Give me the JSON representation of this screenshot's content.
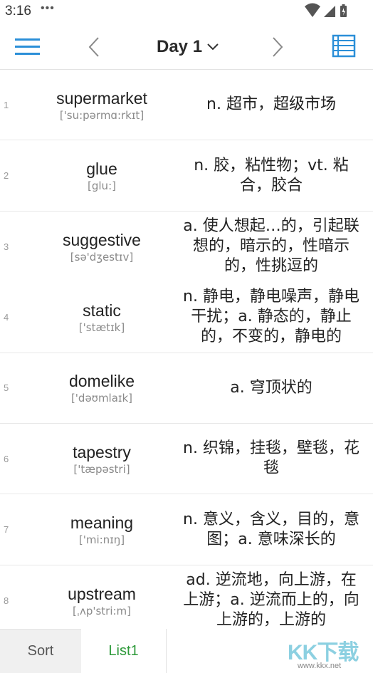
{
  "status_bar": {
    "time": "3:16",
    "dots": "•••"
  },
  "header": {
    "menu_icon": "hamburger-menu-icon",
    "prev_icon": "chevron-left-icon",
    "title": "Day 1",
    "dropdown_icon": "chevron-down-icon",
    "next_icon": "chevron-right-icon",
    "list_icon": "list-view-icon",
    "accent_color": "#2b8fd8"
  },
  "words": [
    {
      "index": "1",
      "word": "supermarket",
      "phonetic": "['su:pərmɑ:rkɪt]",
      "meaning": "n. 超市，超级市场"
    },
    {
      "index": "2",
      "word": "glue",
      "phonetic": "[glu:]",
      "meaning": "n. 胶，粘性物；vt. 粘合，胶合"
    },
    {
      "index": "3",
      "word": "suggestive",
      "phonetic": "[sə'dʒestɪv]",
      "meaning": "a. 使人想起…的，引起联想的，暗示的，性暗示的，性挑逗的"
    },
    {
      "index": "4",
      "word": "static",
      "phonetic": "['stætɪk]",
      "meaning": "n. 静电，静电噪声，静电干扰；a. 静态的，静止的，不变的，静电的"
    },
    {
      "index": "5",
      "word": "domelike",
      "phonetic": "['dəʊmlaɪk]",
      "meaning": "a. 穹顶状的"
    },
    {
      "index": "6",
      "word": "tapestry",
      "phonetic": "['tæpəstri]",
      "meaning": "n. 织锦，挂毯，壁毯，花毯"
    },
    {
      "index": "7",
      "word": "meaning",
      "phonetic": "['mi:nɪŋ]",
      "meaning": "n. 意义，含义，目的，意图；a. 意味深长的"
    },
    {
      "index": "8",
      "word": "upstream",
      "phonetic": "[ˌʌp'stri:m]",
      "meaning": "ad. 逆流地，向上游，在上游；a. 逆流而上的，向上游的，上游的"
    }
  ],
  "bottom_tabs": {
    "sort_label": "Sort",
    "list1_label": "List1",
    "active_color": "#2e9a3a"
  },
  "watermark": {
    "text": "KK下载",
    "url": "www.kkx.net"
  }
}
